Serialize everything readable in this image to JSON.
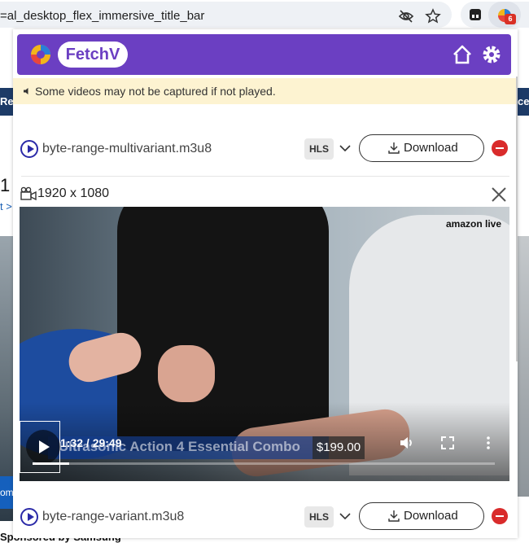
{
  "browser": {
    "url": "=al_desktop_flex_immersive_title_bar",
    "icons": [
      "eye-off-icon",
      "star-icon",
      "tab-search-icon",
      "fetchv-extension-icon"
    ],
    "extension_badge": "6"
  },
  "background_page": {
    "strip_left": "Re",
    "strip_right": "ce",
    "number": "1",
    "link": "t >",
    "blue_text": "om",
    "bottom_text": "Sponsored by Samsung"
  },
  "popup": {
    "logo_text": "FetchV",
    "header_icons": [
      "home-icon",
      "gear-icon"
    ],
    "notice": "Some videos may not be captured if not played.",
    "items": [
      {
        "name": "byte-range-multivariant.m3u8",
        "format": "HLS",
        "download_label": "Download"
      },
      {
        "name": "byte-range-variant.m3u8",
        "format": "HLS",
        "download_label": "Download"
      }
    ],
    "preview": {
      "resolution": "1920 x 1080",
      "brand_watermark": "amazon live",
      "promo_text": "Ultrasonic Action 4 Essential Combo",
      "price": "$199.00",
      "time": "1:32 / 29:49",
      "progress": 0.08
    }
  },
  "colors": {
    "brand_purple": "#6b3fc2",
    "notice_bg": "#fdf3d1",
    "remove_red": "#d92b2b",
    "play_blue": "#2b2aa8"
  }
}
